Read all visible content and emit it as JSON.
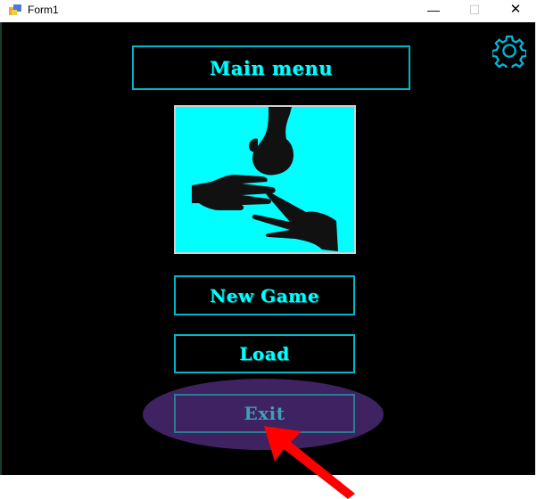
{
  "window": {
    "title": "Form1",
    "minimize_glyph": "—",
    "maximize_glyph": "☐",
    "close_glyph": "✕"
  },
  "main": {
    "menu_title": "Main menu",
    "buttons": {
      "new_game": "New Game",
      "load": "Load",
      "exit": "Exit"
    }
  },
  "icons": {
    "settings": "gear-icon",
    "picture": "rock-paper-scissors-hands",
    "annotation": "red-arrow-pointing-to-exit"
  },
  "colors": {
    "background": "#000000",
    "accent": "#00ffff",
    "border": "#00b7c7",
    "highlight": "#3f2363",
    "arrow": "#ff0000"
  }
}
